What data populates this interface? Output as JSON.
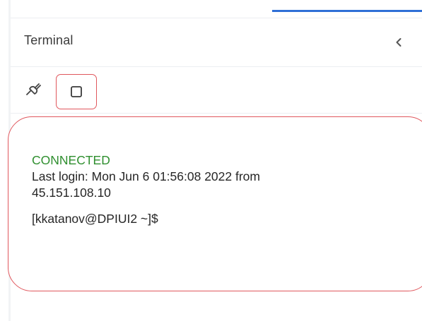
{
  "panel": {
    "title": "Terminal"
  },
  "toolbar": {
    "connect_icon": "plug-icon",
    "stop_icon": "square-icon"
  },
  "terminal": {
    "status": "CONNECTED",
    "last_login_line1": "Last login: Mon Jun  6 01:56:08 2022 from",
    "last_login_line2": "45.151.108.10",
    "prompt": "[kkatanov@DPIUI2 ~]$"
  },
  "colors": {
    "accent": "#2f6fd6",
    "highlight": "#e0575d",
    "connected": "#2f8f2f"
  }
}
